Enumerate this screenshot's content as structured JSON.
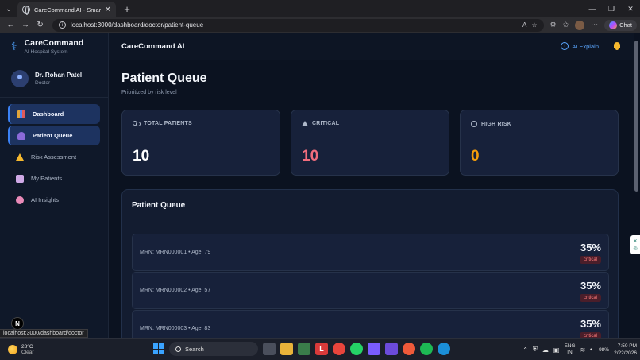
{
  "browser": {
    "tab_title": "CareCommand AI - Smart Digital H",
    "tab_close": "✕",
    "new_tab": "+",
    "url": "localhost:3000/dashboard/doctor/patient-queue",
    "chat_label": "Chat",
    "status_url": "localhost:3000/dashboard/doctor"
  },
  "sidebar": {
    "brand_title": "CareCommand",
    "brand_subtitle": "AI Hospital System",
    "user_name": "Dr. Rohan Patel",
    "user_role": "Doctor",
    "items": [
      {
        "label": "Dashboard",
        "icon": "dashboard-icon",
        "active": true
      },
      {
        "label": "Patient Queue",
        "icon": "patient-queue-icon",
        "active": true
      },
      {
        "label": "Risk Assessment",
        "icon": "warning-icon",
        "active": false
      },
      {
        "label": "My Patients",
        "icon": "clipboard-icon",
        "active": false
      },
      {
        "label": "AI Insights",
        "icon": "brain-icon",
        "active": false
      }
    ],
    "n_badge": "N"
  },
  "topbar": {
    "title": "CareCommand AI",
    "ai_explain_label": "AI Explain"
  },
  "page": {
    "title": "Patient Queue",
    "subtitle": "Prioritized by risk level"
  },
  "stats": [
    {
      "label": "TOTAL PATIENTS",
      "value": "10",
      "color": "#ffffff"
    },
    {
      "label": "CRITICAL",
      "value": "10",
      "color": "#f26d7d"
    },
    {
      "label": "HIGH RISK",
      "value": "0",
      "color": "#f59e0b"
    }
  ],
  "queue": {
    "title": "Patient Queue",
    "rows": [
      {
        "info": "MRN: MRN000001 • Age: 79",
        "percent": "35%",
        "level": "critical"
      },
      {
        "info": "MRN: MRN000002 • Age: 57",
        "percent": "35%",
        "level": "critical"
      },
      {
        "info": "MRN: MRN000003 • Age: 83",
        "percent": "35%",
        "level": "critical"
      }
    ]
  },
  "taskbar": {
    "temperature": "28°C",
    "condition": "Clear",
    "search_placeholder": "Search",
    "lang_top": "ENG",
    "lang_bottom": "IN",
    "battery": "98%",
    "time": "7:50 PM",
    "date": "2/22/2026"
  },
  "colors": {
    "accent": "#3b82f6",
    "critical": "#f26d7d",
    "high_risk": "#f59e0b",
    "background": "#0b1220"
  }
}
